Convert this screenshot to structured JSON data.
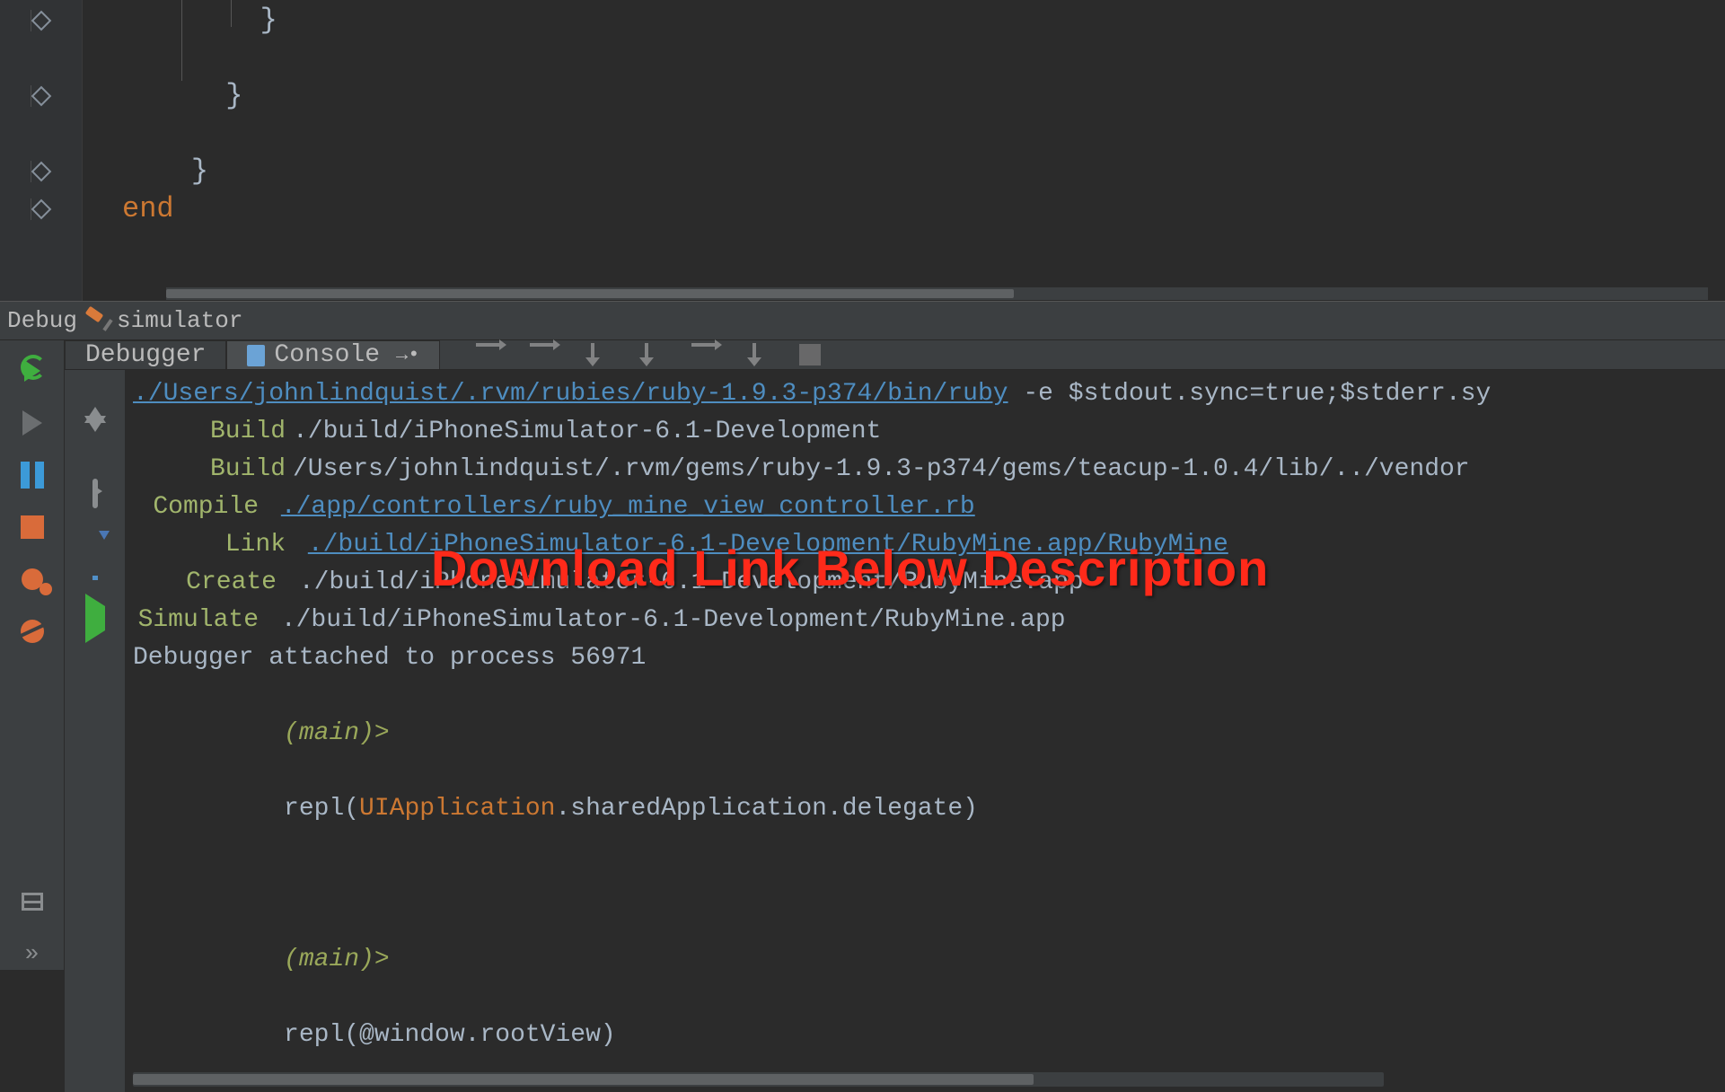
{
  "editor": {
    "lines": [
      "        }",
      "",
      "      }",
      "",
      "    }",
      "end"
    ],
    "end_keyword": "end"
  },
  "debug_header": {
    "title_left": "Debug",
    "title_right": "simulator"
  },
  "tabs": {
    "debugger": "Debugger",
    "console": "Console"
  },
  "console": {
    "line0_link": "./Users/johnlindquist/.rvm/rubies/ruby-1.9.3-p374/bin/ruby",
    "line0_rest": " -e $stdout.sync=true;$stderr.sy",
    "build1_label": "Build",
    "build1_text": "./build/iPhoneSimulator-6.1-Development",
    "build2_label": "Build",
    "build2_text": "/Users/johnlindquist/.rvm/gems/ruby-1.9.3-p374/gems/teacup-1.0.4/lib/../vendor",
    "compile_label": "Compile",
    "compile_link": "./app/controllers/ruby_mine_view_controller.rb",
    "link_label": "Link",
    "link_link": "./build/iPhoneSimulator-6.1-Development/RubyMine.app/RubyMine",
    "create_label": "Create",
    "create_text": "./build/iPhoneSimulator-6.1-Development/RubyMine.app",
    "simulate_label": "Simulate",
    "simulate_text": "./build/iPhoneSimulator-6.1-Development/RubyMine.app",
    "debugger_attached": "Debugger attached to process 56971",
    "prompt1": "(main)>",
    "repl1_a": "repl(",
    "repl1_b": "UIApplication",
    "repl1_c": ".sharedApplication.delegate)",
    "prompt2": "(main)>",
    "repl2_a": "repl(",
    "repl2_b": "@window",
    "repl2_c": ".rootView",
    "repl2_d": ")"
  },
  "watermark": "Download Link Below Description",
  "colors": {
    "bg": "#2b2b2b",
    "panel": "#3c3f41",
    "link": "#4e8dc0",
    "keyword": "#cc7832",
    "prompt": "#9aa85a",
    "red": "#ff2a1a"
  }
}
